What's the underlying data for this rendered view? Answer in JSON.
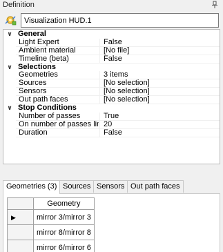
{
  "window": {
    "title": "Definition"
  },
  "object": {
    "name": "Visualization HUD.1"
  },
  "properties": [
    {
      "category": "General",
      "items": [
        {
          "name": "Light Expert",
          "value": "False"
        },
        {
          "name": "Ambient material",
          "value": "[No file]"
        },
        {
          "name": "Timeline (beta)",
          "value": "False"
        }
      ]
    },
    {
      "category": "Selections",
      "items": [
        {
          "name": "Geometries",
          "value": "3 items"
        },
        {
          "name": "Sources",
          "value": "[No selection]"
        },
        {
          "name": "Sensors",
          "value": "[No selection]"
        },
        {
          "name": "Out path faces",
          "value": "[No selection]"
        }
      ]
    },
    {
      "category": "Stop Conditions",
      "items": [
        {
          "name": "Number of passes",
          "value": "True"
        },
        {
          "name": "On number of passes limit",
          "value": "20"
        },
        {
          "name": "Duration",
          "value": "False"
        }
      ]
    }
  ],
  "tabs": [
    {
      "label": "Geometries (3)",
      "active": true
    },
    {
      "label": "Sources",
      "active": false
    },
    {
      "label": "Sensors",
      "active": false
    },
    {
      "label": "Out path faces",
      "active": false
    }
  ],
  "geometry_table": {
    "column": "Geometry",
    "rows": [
      "mirror 3/mirror 3",
      "mirror 8/mirror 8",
      "mirror 6/mirror 6"
    ],
    "current_row_marker": "▶"
  }
}
